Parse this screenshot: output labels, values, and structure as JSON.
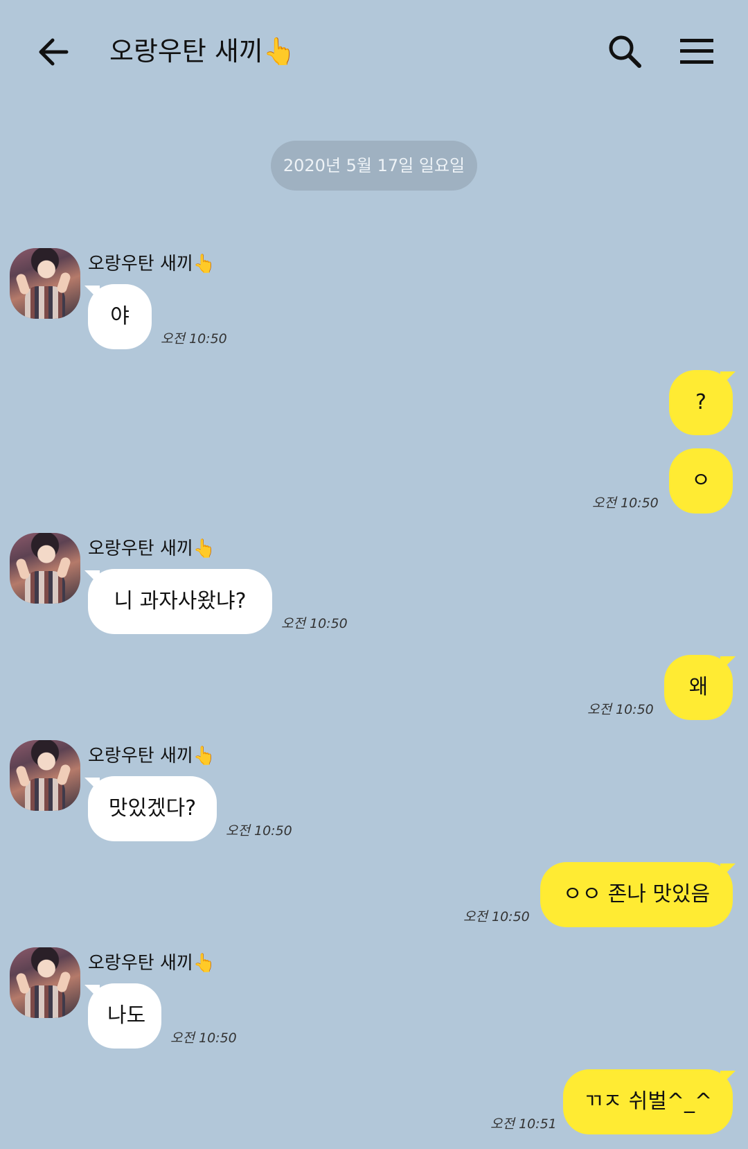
{
  "header": {
    "title": "오랑우탄 새끼👆"
  },
  "date_divider": "2020년 5월 17일 일요일",
  "sender_name": "오랑우탄 새끼👆",
  "messages": [
    {
      "text": "야",
      "time": "오전 10:50"
    },
    {
      "text": "?"
    },
    {
      "text": "ㅇ",
      "time": "오전 10:50"
    },
    {
      "text": "니 과자사왔냐?",
      "time": "오전 10:50"
    },
    {
      "text": "왜",
      "time": "오전 10:50"
    },
    {
      "text": "맛있겠다?",
      "time": "오전 10:50"
    },
    {
      "text": "ㅇㅇ 존나 맛있음",
      "time": "오전 10:50"
    },
    {
      "text": "나도",
      "time": "오전 10:50"
    },
    {
      "text": "ㄲㅈ 쉬벌^_^",
      "time": "오전 10:51"
    }
  ],
  "colors": {
    "background": "#b2c7d9",
    "incoming_bubble": "#ffffff",
    "outgoing_bubble": "#ffeb33",
    "date_pill": "#9fb1c1"
  }
}
